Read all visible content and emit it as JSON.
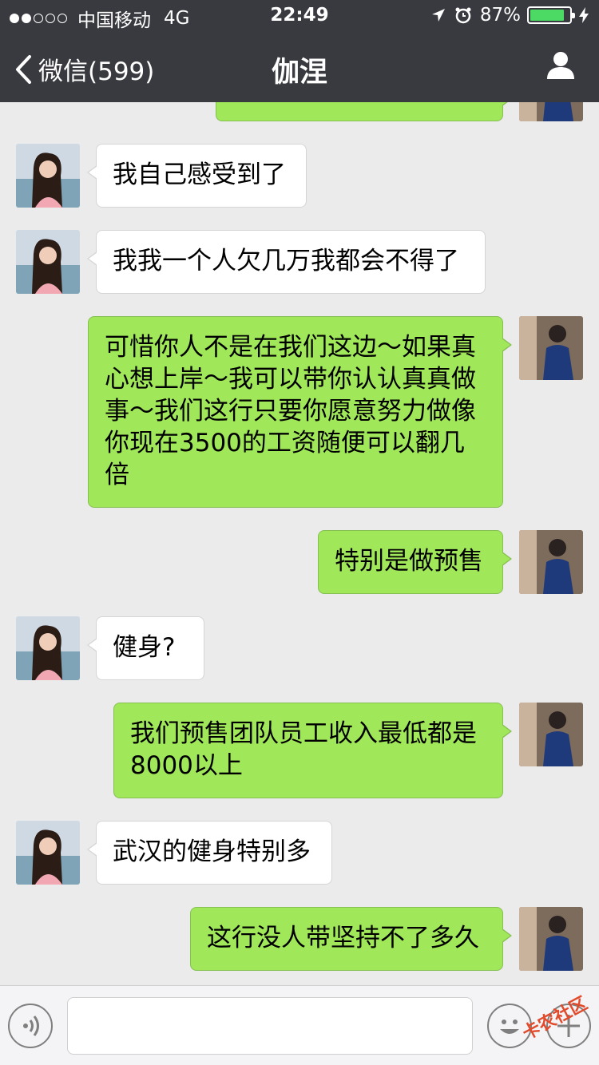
{
  "status_bar": {
    "carrier": "中国移动",
    "network": "4G",
    "time": "22:49",
    "battery_text": "87%",
    "battery_level": 0.87,
    "signal_bars_filled": 2,
    "signal_bars_total": 5
  },
  "nav": {
    "back_label": "微信(599)",
    "title": "伽涅"
  },
  "messages": [
    {
      "side": "in",
      "text": "我自己感受到了"
    },
    {
      "side": "in",
      "text": "我我一个人欠几万我都会不得了"
    },
    {
      "side": "out",
      "text": "可惜你人不是在我们这边～如果真心想上岸～我可以带你认认真真做事～我们这行只要你愿意努力做像你现在3500的工资随便可以翻几倍"
    },
    {
      "side": "out",
      "text": "特别是做预售"
    },
    {
      "side": "in",
      "text": "健身?"
    },
    {
      "side": "out",
      "text": "我们预售团队员工收入最低都是8000以上"
    },
    {
      "side": "in",
      "text": "武汉的健身特别多"
    },
    {
      "side": "out",
      "text": "这行没人带坚持不了多久"
    }
  ],
  "watermark": "卡农社区",
  "colors": {
    "nav_bg": "#393a3f",
    "chat_bg": "#ebebeb",
    "out_bubble": "#a0e75a",
    "in_bubble": "#ffffff",
    "battery": "#4cd964"
  },
  "icons": {
    "back": "chevron-left-icon",
    "profile": "person-icon",
    "location": "location-arrow-icon",
    "alarm": "alarm-clock-icon",
    "charging": "charging-bolt-icon",
    "voice": "voice-icon",
    "emoji": "emoji-icon",
    "plus": "plus-icon"
  }
}
